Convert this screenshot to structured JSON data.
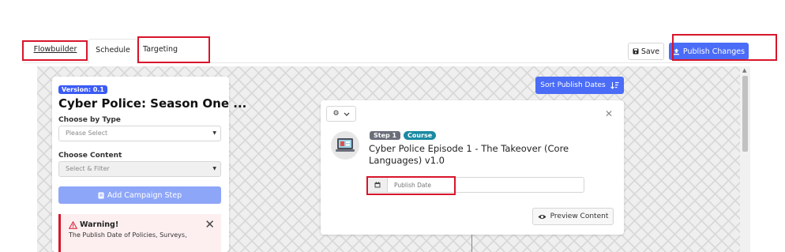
{
  "tabs": {
    "flowbuilder": "Flowbuilder",
    "schedule": "Schedule",
    "targeting": "Targeting"
  },
  "toolbar": {
    "save_label": "Save",
    "publish_label": "Publish Changes"
  },
  "left_panel": {
    "version_badge": "Version: 0.1",
    "campaign_title": "Cyber Police: Season One ...",
    "choose_type_label": "Choose by Type",
    "type_placeholder": "Please Select",
    "choose_content_label": "Choose Content",
    "content_placeholder": "Select & Filter",
    "add_step_label": "Add Campaign Step",
    "warning_title": "Warning!",
    "warning_text": "The Publish Date of Policies, Surveys,"
  },
  "sort_button_label": "Sort Publish Dates",
  "card": {
    "step_badge": "Step 1",
    "type_badge": "Course",
    "title": "Cyber Police Episode 1 - The Takeover (Core Languages) v1.0",
    "date_placeholder": "Publish Date",
    "preview_label": "Preview Content"
  },
  "colors": {
    "accent": "#4a6cf7",
    "annotation_red": "#d8152b",
    "course_badge": "#1a8aa2"
  }
}
